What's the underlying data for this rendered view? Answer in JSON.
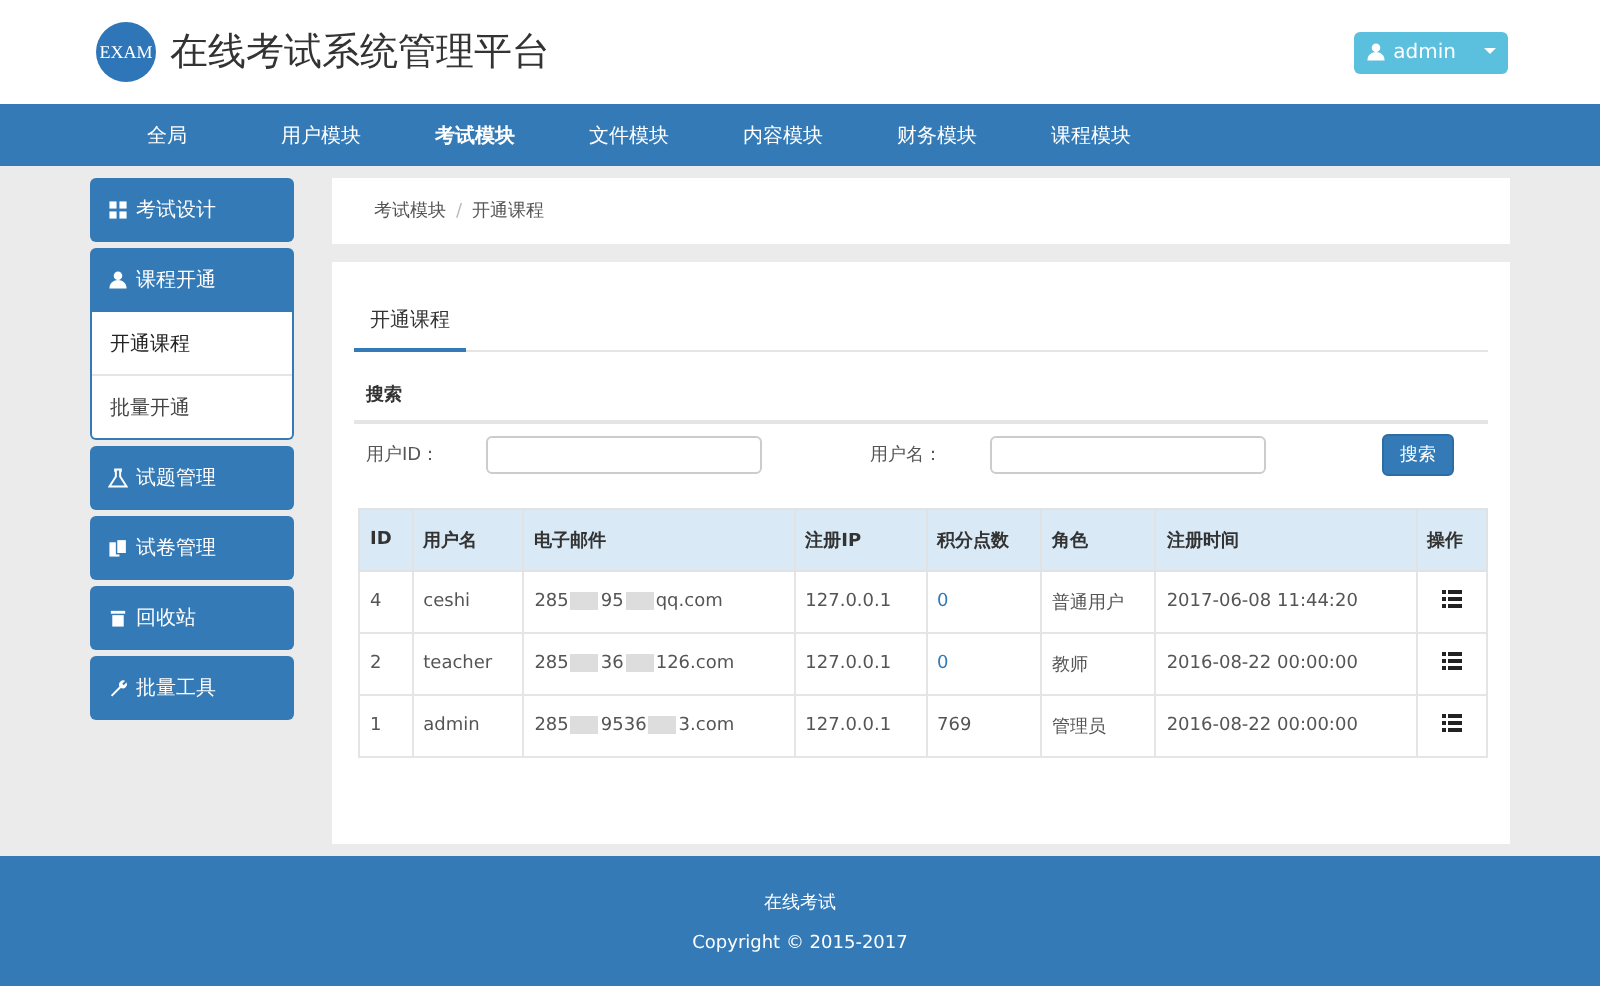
{
  "header": {
    "logo": "EXAM",
    "title": "在线考试系统管理平台",
    "user": "admin"
  },
  "nav": [
    {
      "label": "全局",
      "selected": false
    },
    {
      "label": "用户模块",
      "selected": false
    },
    {
      "label": "考试模块",
      "selected": true
    },
    {
      "label": "文件模块",
      "selected": false
    },
    {
      "label": "内容模块",
      "selected": false
    },
    {
      "label": "财务模块",
      "selected": false
    },
    {
      "label": "课程模块",
      "selected": false
    }
  ],
  "sidebar": [
    {
      "label": "考试设计",
      "expanded": false
    },
    {
      "label": "课程开通",
      "expanded": true,
      "children": [
        {
          "label": "开通课程",
          "selected": true
        },
        {
          "label": "批量开通",
          "selected": false
        }
      ]
    },
    {
      "label": "试题管理",
      "expanded": false
    },
    {
      "label": "试卷管理",
      "expanded": false
    },
    {
      "label": "回收站",
      "expanded": false
    },
    {
      "label": "批量工具",
      "expanded": false
    }
  ],
  "breadcrumb": {
    "items": [
      "考试模块",
      "开通课程"
    ],
    "separator": "/"
  },
  "tab": "开通课程",
  "search": {
    "title": "搜索",
    "fields": [
      {
        "label": "用户ID："
      },
      {
        "label": "用户名："
      }
    ],
    "button": "搜索"
  },
  "table": {
    "columns": [
      "ID",
      "用户名",
      "电子邮件",
      "注册IP",
      "积分点数",
      "角色",
      "注册时间",
      "操作"
    ],
    "rows": [
      {
        "id": "4",
        "name": "ceshi",
        "email": [
          "285",
          "95",
          "qq.com"
        ],
        "ip": "127.0.0.1",
        "points": "0",
        "linked": true,
        "role": "普通用户",
        "time": "2017-06-08 11:44:20"
      },
      {
        "id": "2",
        "name": "teacher",
        "email": [
          "285",
          "36",
          "126.com"
        ],
        "ip": "127.0.0.1",
        "points": "0",
        "linked": true,
        "role": "教师",
        "time": "2016-08-22 00:00:00"
      },
      {
        "id": "1",
        "name": "admin",
        "email": [
          "285",
          "9536",
          "3.com"
        ],
        "ip": "127.0.0.1",
        "points": "769",
        "linked": false,
        "role": "管理员",
        "time": "2016-08-22 00:00:00"
      }
    ]
  },
  "footer": {
    "name": "在线考试",
    "copyright": "Copyright © 2015-2017"
  }
}
